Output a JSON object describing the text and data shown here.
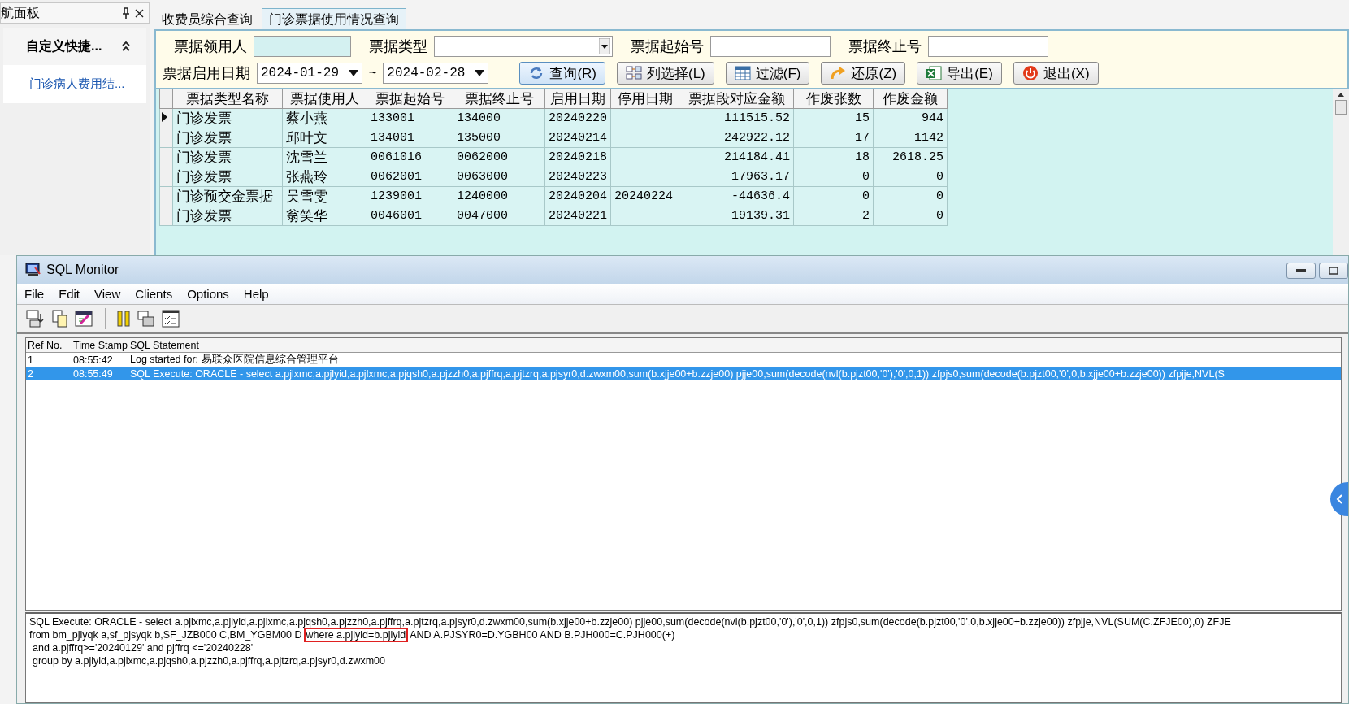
{
  "nav_panel": {
    "title": "航面板",
    "group": {
      "label": "自定义快捷...",
      "expanded": true
    },
    "items": [
      {
        "label": "门诊病人费用结..."
      }
    ]
  },
  "tabs": [
    {
      "label": "收费员综合查询",
      "selected": false
    },
    {
      "label": "门诊票据使用情况查询",
      "selected": true
    }
  ],
  "filters": [
    {
      "label": "票据领用人",
      "kind": "text",
      "highlighted": true
    },
    {
      "label": "票据类型",
      "kind": "select",
      "highlighted": false
    },
    {
      "label": "票据起始号",
      "kind": "text",
      "highlighted": false
    },
    {
      "label": "票据终止号",
      "kind": "text",
      "highlighted": false
    }
  ],
  "date_range": {
    "label": "票据启用日期",
    "from": "2024-01-29",
    "separator": "~",
    "to": "2024-02-28"
  },
  "buttons": [
    {
      "label": "查询(R)"
    },
    {
      "label": "列选择(L)"
    },
    {
      "label": "过滤(F)"
    },
    {
      "label": "还原(Z)"
    },
    {
      "label": "导出(E)"
    },
    {
      "label": "退出(X)"
    }
  ],
  "table": {
    "columns": [
      "票据类型名称",
      "票据使用人",
      "票据起始号",
      "票据终止号",
      "启用日期",
      "停用日期",
      "票据段对应金额",
      "作废张数",
      "作废金额"
    ],
    "rows": [
      {
        "current": true,
        "cells": [
          "门诊发票",
          "蔡小燕",
          "133001",
          "134000",
          "20240220",
          "",
          "111515.52",
          "15",
          "944"
        ]
      },
      {
        "current": false,
        "cells": [
          "门诊发票",
          "邱叶文",
          "134001",
          "135000",
          "20240214",
          "",
          "242922.12",
          "17",
          "1142"
        ]
      },
      {
        "current": false,
        "cells": [
          "门诊发票",
          "沈雪兰",
          "0061016",
          "0062000",
          "20240218",
          "",
          "214184.41",
          "18",
          "2618.25"
        ]
      },
      {
        "current": false,
        "cells": [
          "门诊发票",
          "张燕玲",
          "0062001",
          "0063000",
          "20240223",
          "",
          "17963.17",
          "0",
          "0"
        ]
      },
      {
        "current": false,
        "cells": [
          "门诊预交金票据",
          "吴雪雯",
          "1239001",
          "1240000",
          "20240204",
          "20240224",
          "-44636.4",
          "0",
          "0"
        ]
      },
      {
        "current": false,
        "cells": [
          "门诊发票",
          "翁笑华",
          "0046001",
          "0047000",
          "20240221",
          "",
          "19139.31",
          "2",
          "0"
        ]
      }
    ]
  },
  "sql_monitor": {
    "title": "SQL Monitor",
    "menu": [
      "File",
      "Edit",
      "View",
      "Clients",
      "Options",
      "Help"
    ],
    "log": {
      "columns": [
        "Ref No.",
        "Time Stamp",
        "SQL Statement"
      ],
      "rows": [
        {
          "ref": "1",
          "time": "08:55:42",
          "statement": "Log started for: 易联众医院信息综合管理平台",
          "selected": false
        },
        {
          "ref": "2",
          "time": "08:55:49",
          "statement": "SQL Execute: ORACLE - select a.pjlxmc,a.pjlyid,a.pjlxmc,a.pjqsh0,a.pjzzh0,a.pjffrq,a.pjtzrq,a.pjsyr0,d.zwxm00,sum(b.xjje00+b.zzje00) pjje00,sum(decode(nvl(b.pjzt00,'0'),'0',0,1)) zfpjs0,sum(decode(b.pjzt00,'0',0,b.xjje00+b.zzje00)) zfpjje,NVL(S",
          "selected": true
        }
      ]
    },
    "detail_lines": [
      {
        "parts": [
          {
            "text": "SQL Execute: ORACLE - select a.pjlxmc,a.pjlyid,a.pjlxmc,a.pjqsh0,a.pjzzh0,a.pjffrq,a.pjtzrq,a.pjsyr0,d.zwxm00,sum(b.xjje00+b.zzje00) pjje00,sum(decode(nvl(b.pjzt00,'0'),'0',0,1)) zfpjs0,sum(decode(b.pjzt00,'0',0,b.xjje00+b.zzje00)) zfpjje,NVL(SUM(C.ZFJE00),0) ZFJE",
            "highlighted": false
          }
        ]
      },
      {
        "parts": [
          {
            "text": "from bm_pjlyqk a,sf_pjsyqk b,SF_JZB000 C,BM_YGBM00 D",
            "highlighted": false
          },
          {
            "text": "where a.pjlyid=b.pjlyid",
            "highlighted": true
          },
          {
            "text": "AND A.PJSYR0=D.YGBH00 AND  B.PJH000=C.PJH000(+)",
            "highlighted": false
          }
        ]
      },
      {
        "parts": [
          {
            "text": "and a.pjffrq>='20240129' and pjffrq <='20240228'",
            "highlighted": false
          }
        ]
      },
      {
        "parts": [
          {
            "text": "group by a.pjlyid,a.pjlxmc,a.pjqsh0,a.pjzzh0,a.pjffrq,a.pjtzrq,a.pjsyr0,d.zwxm00",
            "highlighted": false
          }
        ]
      }
    ]
  }
}
